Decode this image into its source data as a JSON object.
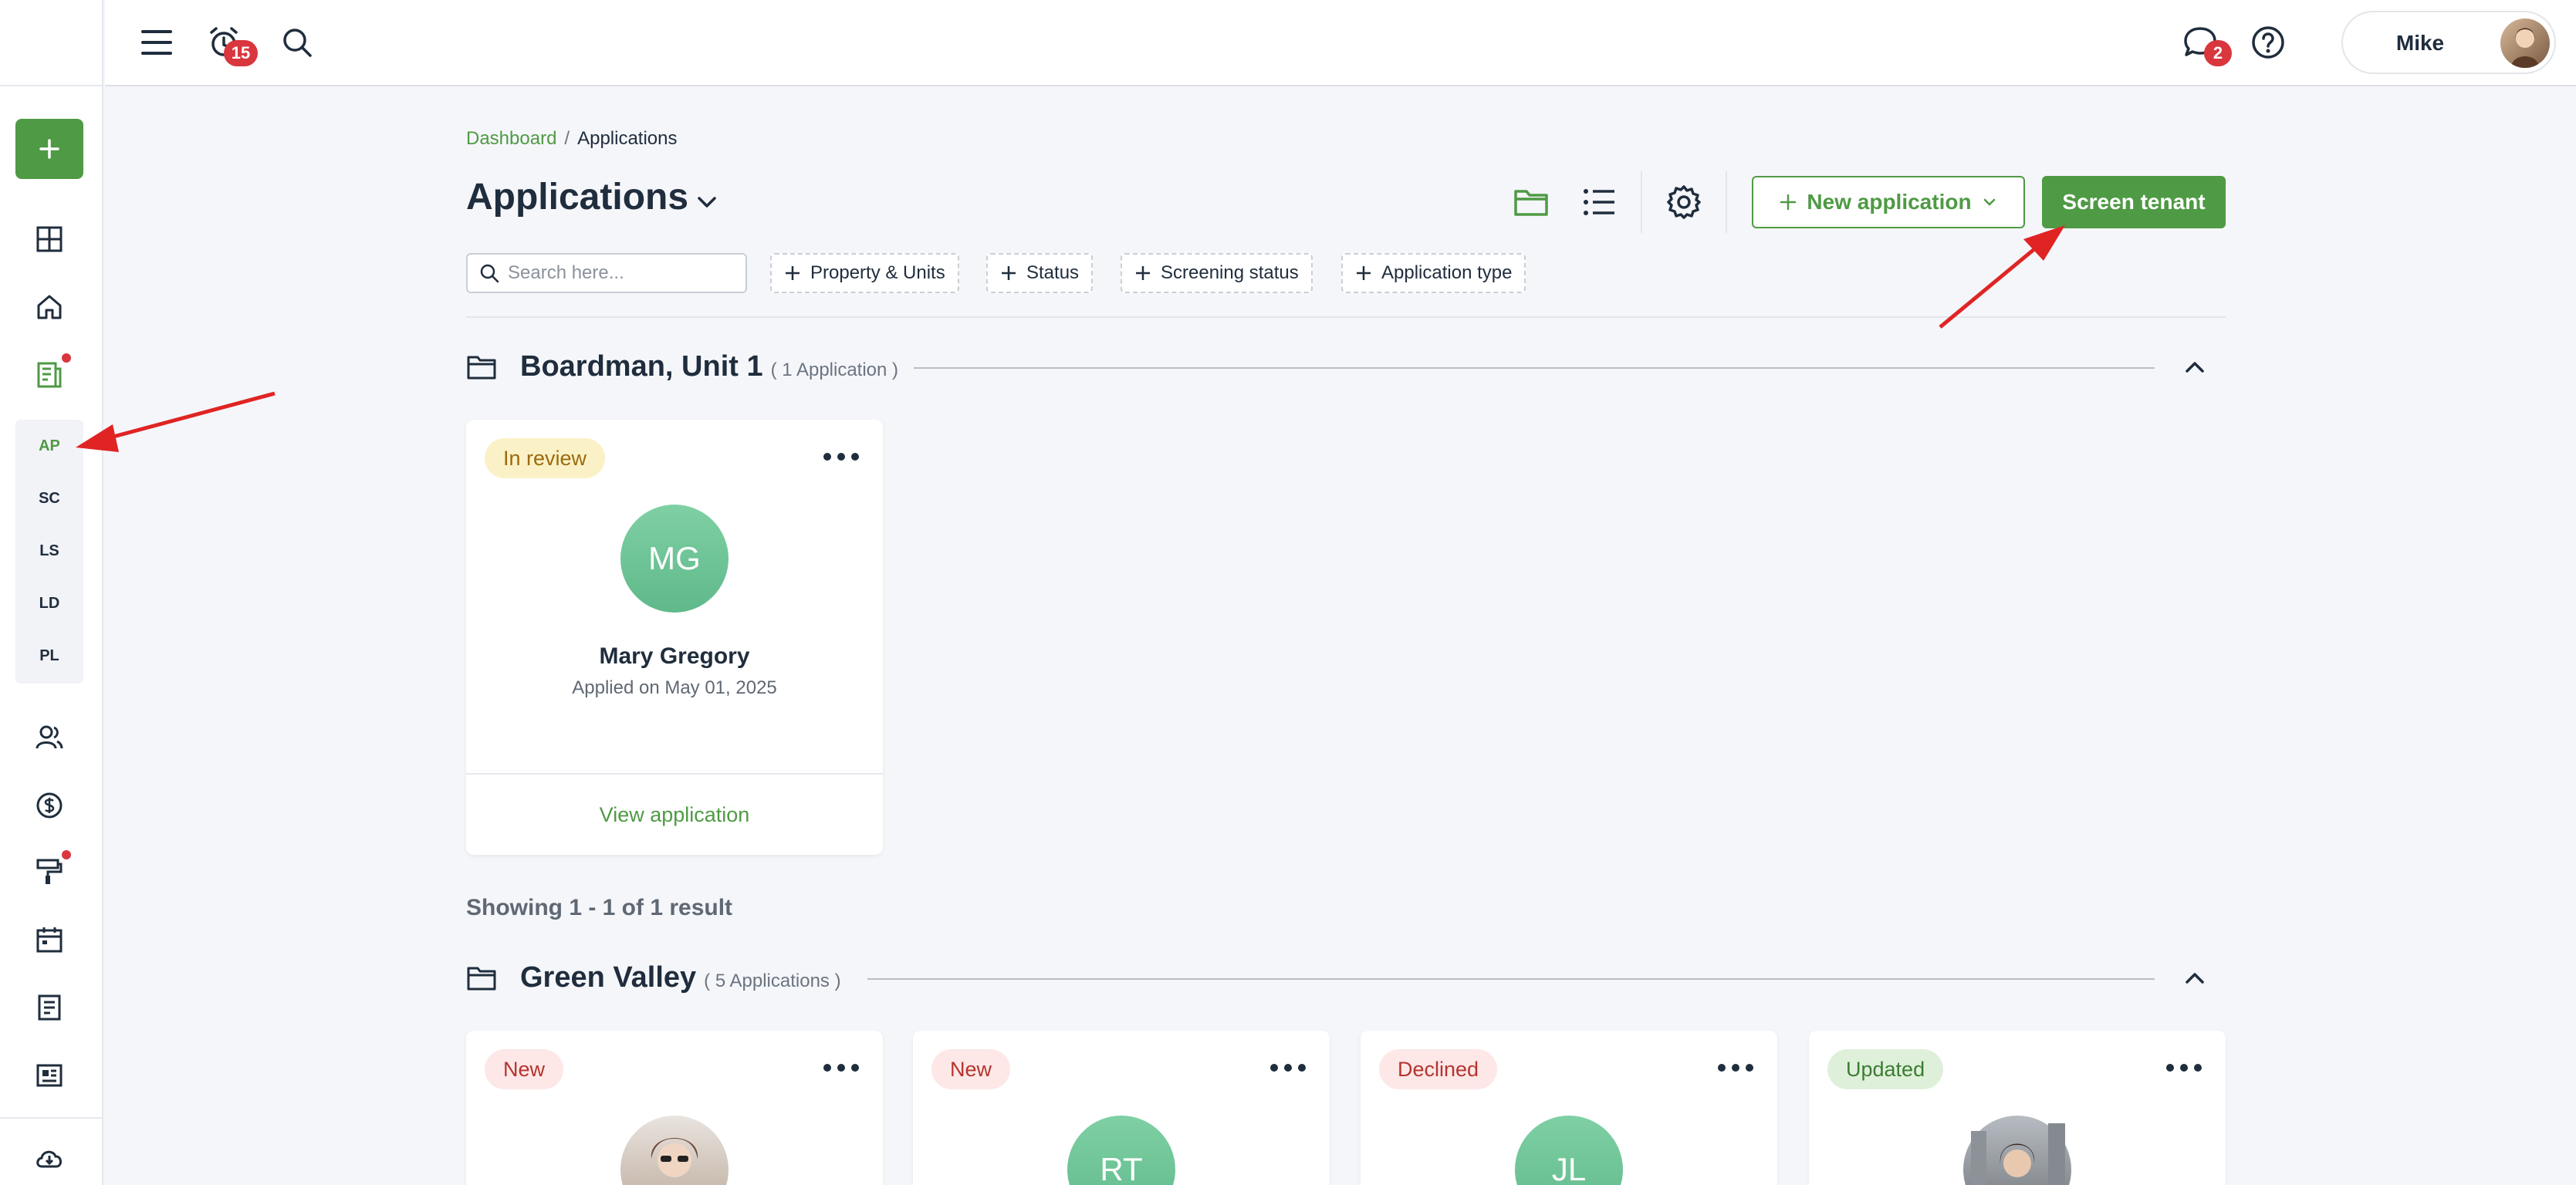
{
  "topbar": {
    "alarm_badge": "15",
    "chat_badge": "2",
    "user_name": "Mike"
  },
  "sidebar": {
    "sub_items": [
      "AP",
      "SC",
      "LS",
      "LD",
      "PL"
    ],
    "active_sub": "AP"
  },
  "breadcrumb": {
    "root": "Dashboard",
    "separator": "/",
    "current": "Applications"
  },
  "page": {
    "title": "Applications",
    "new_application": "New application",
    "screen_tenant": "Screen tenant",
    "search_placeholder": "Search here...",
    "filters": [
      "Property & Units",
      "Status",
      "Screening status",
      "Application type"
    ]
  },
  "groups": [
    {
      "title": "Boardman, Unit 1",
      "count": "( 1 Application )",
      "cards": [
        {
          "status": "In review",
          "initials": "MG",
          "name": "Mary Gregory",
          "date": "Applied on May 01, 2025",
          "action": "View application"
        }
      ],
      "showing": "Showing 1 - 1 of 1 result"
    },
    {
      "title": "Green Valley",
      "count": "( 5 Applications )",
      "cards": [
        {
          "status": "New",
          "initials": ""
        },
        {
          "status": "New",
          "initials": "RT"
        },
        {
          "status": "Declined",
          "initials": "JL"
        },
        {
          "status": "Updated",
          "initials": ""
        }
      ]
    }
  ],
  "colors": {
    "brand_green": "#4f9a44",
    "badge_red": "#d9363e",
    "annotation_arrow": "#e02424"
  }
}
